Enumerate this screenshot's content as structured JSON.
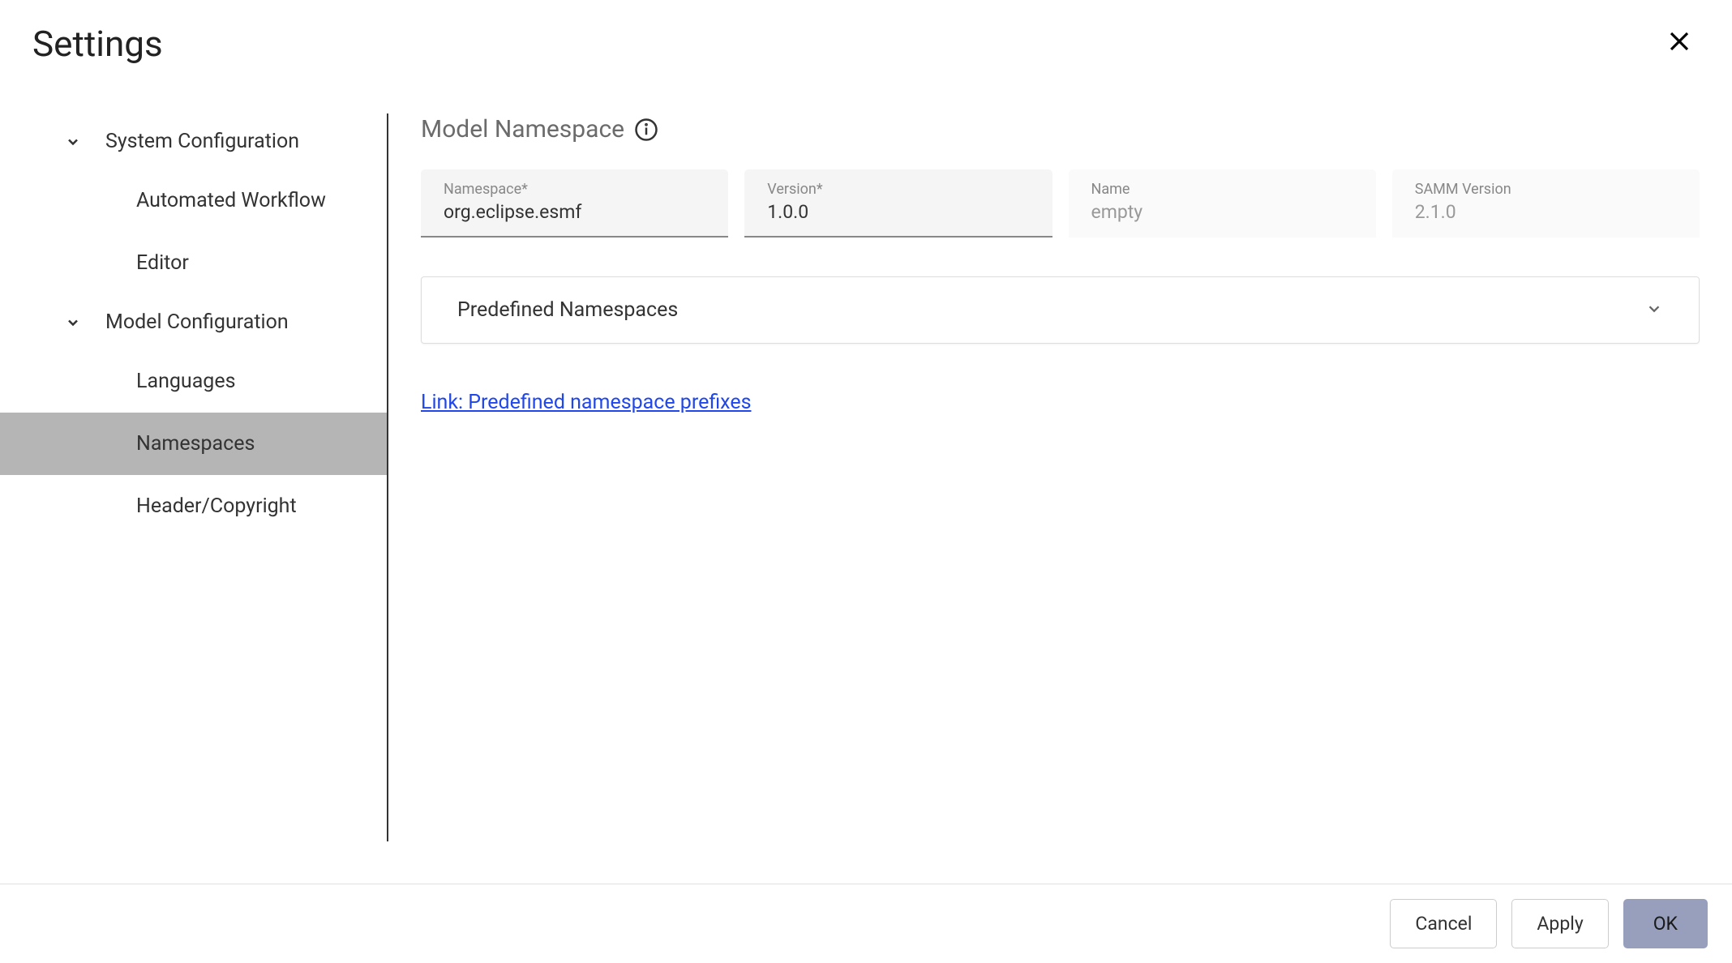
{
  "header": {
    "title": "Settings"
  },
  "sidebar": {
    "sections": [
      {
        "label": "System Configuration",
        "items": [
          {
            "label": "Automated Workflow"
          },
          {
            "label": "Editor"
          }
        ]
      },
      {
        "label": "Model Configuration",
        "items": [
          {
            "label": "Languages"
          },
          {
            "label": "Namespaces"
          },
          {
            "label": "Header/Copyright"
          }
        ]
      }
    ]
  },
  "main": {
    "title": "Model Namespace",
    "fields": {
      "namespace": {
        "label": "Namespace*",
        "value": "org.eclipse.esmf"
      },
      "version": {
        "label": "Version*",
        "value": "1.0.0"
      },
      "name": {
        "label": "Name",
        "value": "empty"
      },
      "sammVersion": {
        "label": "SAMM Version",
        "value": "2.1.0"
      }
    },
    "expansion": {
      "title": "Predefined Namespaces"
    },
    "link": {
      "text": "Link: Predefined namespace prefixes"
    }
  },
  "footer": {
    "cancel": "Cancel",
    "apply": "Apply",
    "ok": "OK"
  }
}
